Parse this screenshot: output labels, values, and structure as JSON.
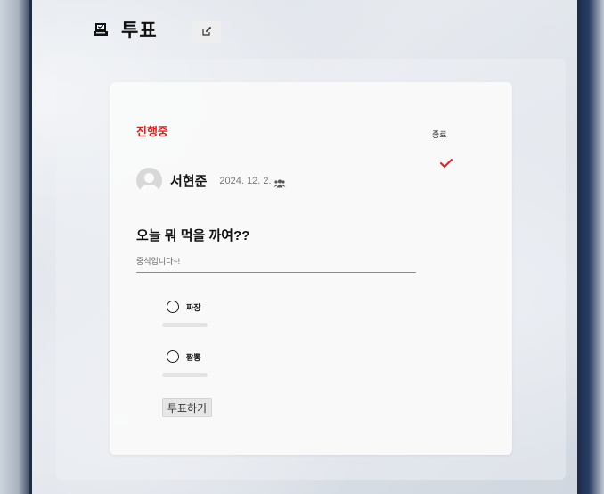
{
  "header": {
    "title": "투표"
  },
  "poll": {
    "status": "진행중",
    "end_label": "종료",
    "author": "서현준",
    "date": "2024. 12. 2.",
    "question": "오늘 뭐 먹을 까여??",
    "description": "중식입니다~!",
    "options": [
      {
        "label": "짜장",
        "progress": 0
      },
      {
        "label": "짬뽕",
        "progress": 0
      }
    ],
    "vote_button": "투표하기"
  },
  "colors": {
    "status": "#e01f1f",
    "check": "#e01f1f"
  },
  "icons": {
    "header": "ballot-box-icon",
    "edit": "edit-icon",
    "check": "check-icon",
    "participants": "group-icon",
    "avatar": "user-avatar-icon"
  }
}
